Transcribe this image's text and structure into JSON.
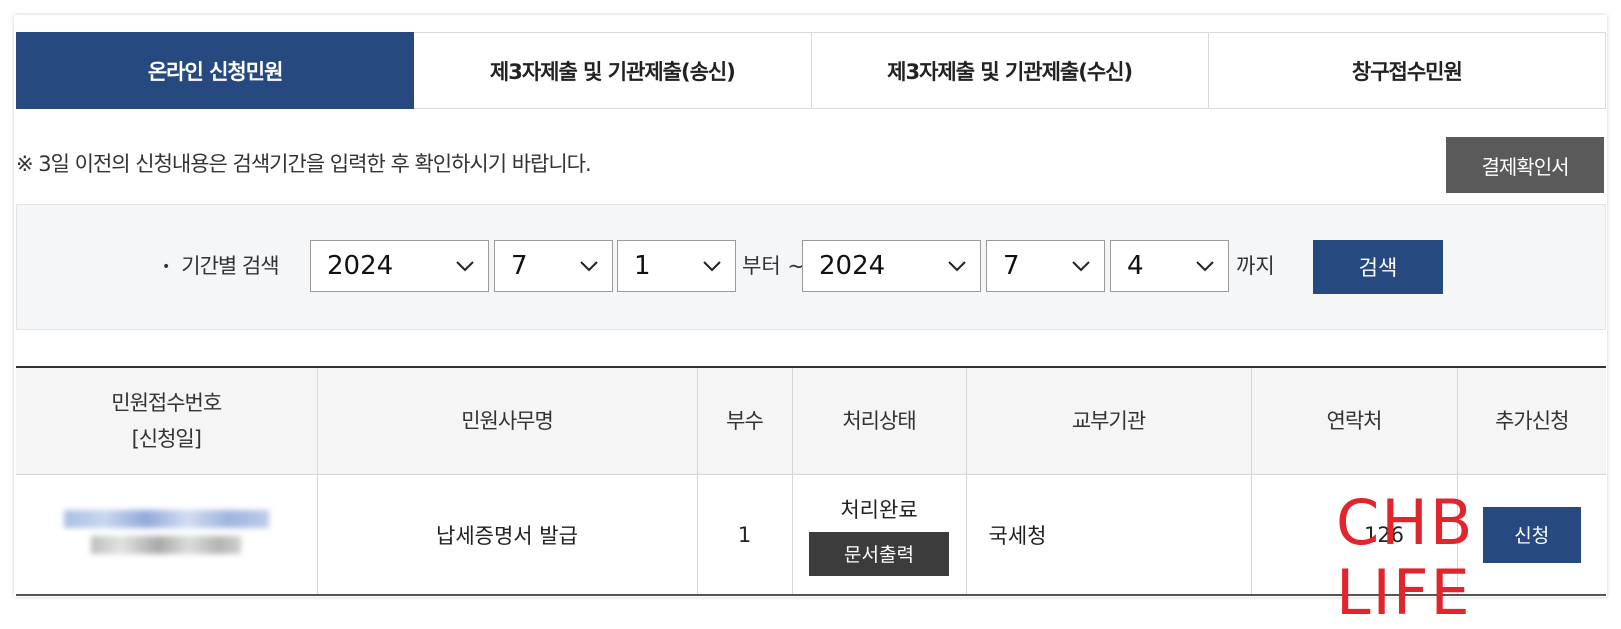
{
  "tabs": [
    {
      "label": "온라인 신청민원",
      "active": true
    },
    {
      "label": "제3자제출 및 기관제출(송신)",
      "active": false
    },
    {
      "label": "제3자제출 및 기관제출(수신)",
      "active": false
    },
    {
      "label": "창구접수민원",
      "active": false
    }
  ],
  "notice": "※ 3일 이전의 신청내용은 검색기간을 입력한 후 확인하시기 바랍니다.",
  "receipt_button": "결제확인서",
  "search": {
    "label": "기간별 검색",
    "bullet": "•",
    "from": {
      "year": "2024",
      "month": "7",
      "day": "1"
    },
    "from_suffix": "부터 ~",
    "to": {
      "year": "2024",
      "month": "7",
      "day": "4"
    },
    "to_suffix": "까지",
    "button": "검색"
  },
  "table": {
    "headers": {
      "receipt_no": "민원접수번호",
      "receipt_date": "[신청일]",
      "name": "민원사무명",
      "copies": "부수",
      "status": "처리상태",
      "agency": "교부기관",
      "contact": "연락처",
      "extra": "추가신청"
    },
    "rows": [
      {
        "name": "납세증명서 발급",
        "copies": "1",
        "status": "처리완료",
        "print_button": "문서출력",
        "agency": "국세청",
        "contact": "126",
        "apply_button": "신청"
      }
    ]
  },
  "watermark": "CHB LIFE",
  "colors": {
    "primary": "#264a80",
    "dark_button": "#3c3c3c",
    "gray_button": "#5a5a5a",
    "watermark": "#e0252c"
  }
}
